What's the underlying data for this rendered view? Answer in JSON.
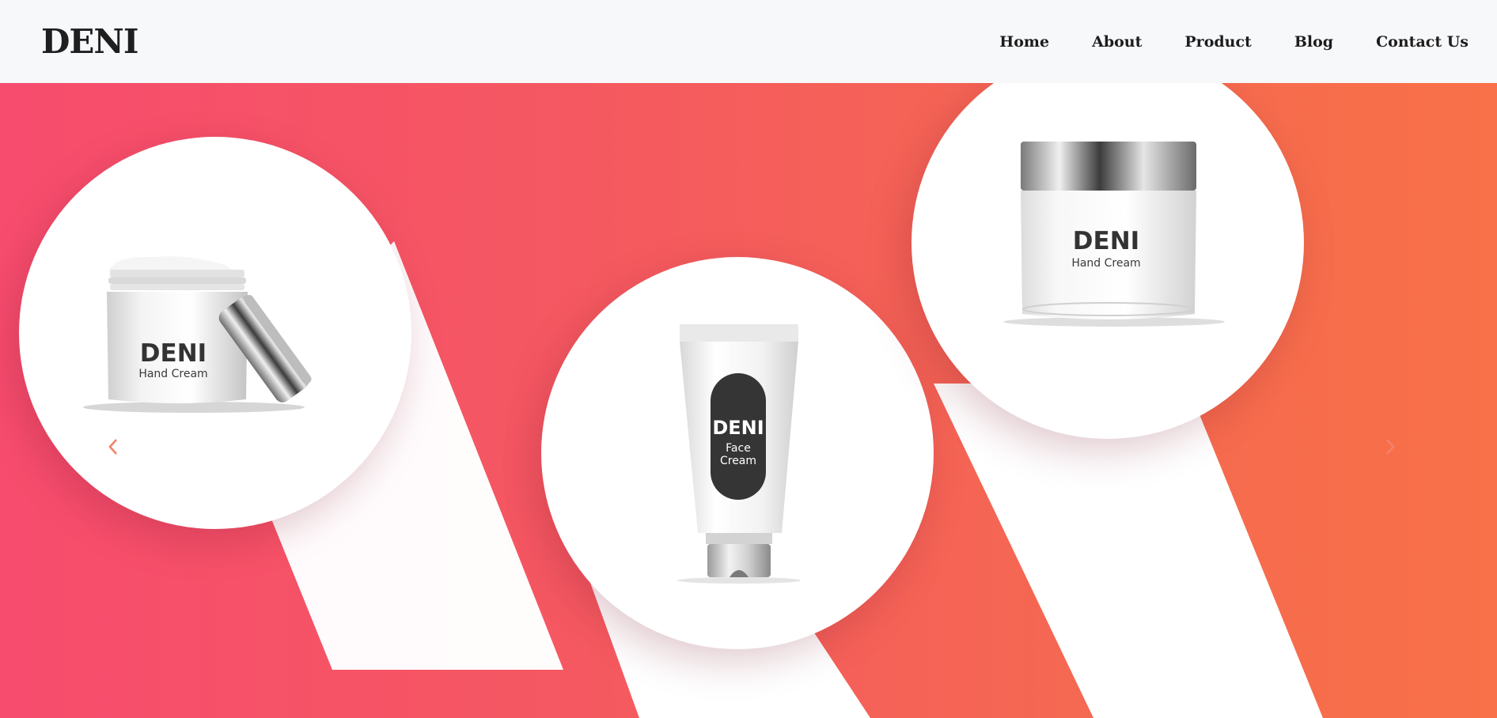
{
  "brand": {
    "name": "DENI"
  },
  "nav": {
    "items": [
      {
        "label": "Home"
      },
      {
        "label": "About"
      },
      {
        "label": "Product"
      },
      {
        "label": "Blog"
      },
      {
        "label": "Contact Us"
      }
    ]
  },
  "hero": {
    "colors": {
      "gradient_start": "#f74c6e",
      "gradient_end": "#f87148",
      "arrow": "#f4826a"
    },
    "products": [
      {
        "brand": "DENI",
        "name": "Hand Cream"
      },
      {
        "brand": "DENI",
        "name_line1": "Face",
        "name_line2": "Cream"
      },
      {
        "brand": "DENI",
        "name": "Hand Cream"
      }
    ],
    "controls": {
      "prev_icon": "chevron-left-icon",
      "next_icon": "chevron-right-icon"
    }
  }
}
